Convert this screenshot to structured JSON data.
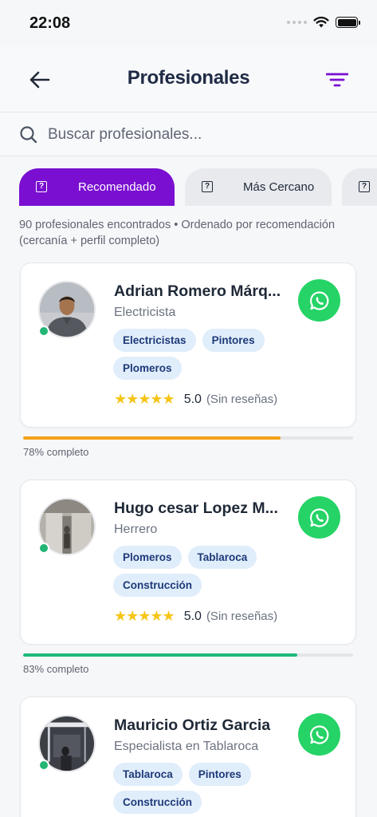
{
  "status_bar": {
    "time": "22:08"
  },
  "header": {
    "title": "Profesionales"
  },
  "search": {
    "placeholder": "Buscar profesionales..."
  },
  "chips": [
    {
      "label": "Recomendado",
      "active": true
    },
    {
      "label": "Más Cercano",
      "active": false
    },
    {
      "label": "",
      "active": false
    }
  ],
  "results_info": "90 profesionales encontrados • Ordenado por recomendación (cercanía + perfil completo)",
  "professionals": [
    {
      "name": "Adrian Romero Márq...",
      "role": "Electricista",
      "tags": [
        "Electricistas",
        "Pintores",
        "Plomeros"
      ],
      "stars": "★★★★★",
      "rating": "5.0",
      "reviews": "(Sin reseñas)",
      "completion": 0.78,
      "completion_label": "78% completo",
      "progress_color": "#f4a118"
    },
    {
      "name": "Hugo cesar Lopez M...",
      "role": "Herrero",
      "tags": [
        "Plomeros",
        "Tablaroca",
        "Construcción"
      ],
      "stars": "★★★★★",
      "rating": "5.0",
      "reviews": "(Sin reseñas)",
      "completion": 0.83,
      "completion_label": "83% completo",
      "progress_color": "#1fb97a"
    },
    {
      "name": "Mauricio Ortiz Garcia",
      "role": "Especialista en Tablaroca",
      "tags": [
        "Tablaroca",
        "Pintores",
        "Construcción"
      ]
    }
  ],
  "colors": {
    "accent": "#7a0fd1",
    "whatsapp": "#25d366",
    "tag_bg": "#e0edfb",
    "tag_text": "#1e3a78",
    "online": "#22b573"
  }
}
